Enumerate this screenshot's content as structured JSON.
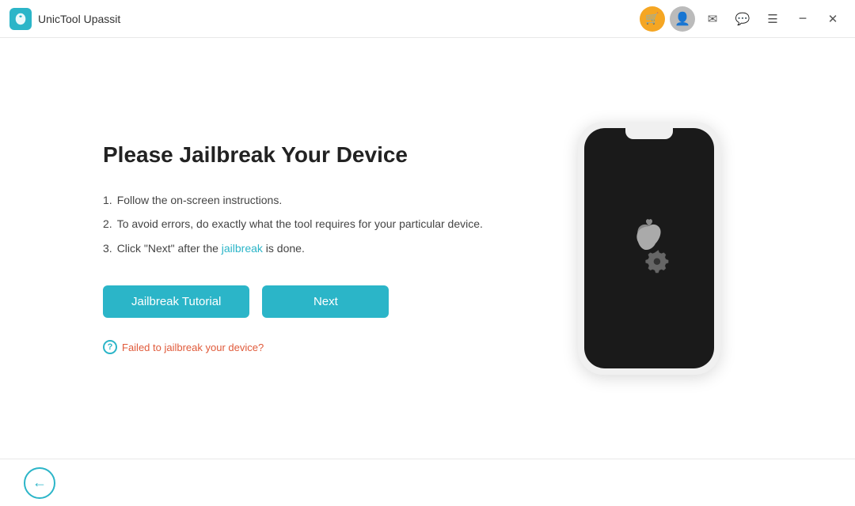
{
  "app": {
    "title": "UnicTool Upassit",
    "icon_symbol": "🔐"
  },
  "titlebar": {
    "cart_icon": "🛒",
    "profile_icon": "👤",
    "mail_icon": "✉",
    "chat_icon": "💬",
    "menu_icon": "☰",
    "minimize_label": "−",
    "close_label": "✕"
  },
  "main": {
    "title": "Please Jailbreak Your Device",
    "instructions": [
      {
        "num": "1.",
        "text": "Follow the on-screen instructions.",
        "highlight": ""
      },
      {
        "num": "2.",
        "text_before": "To avoid errors, do exactly what the tool requires for your particular device.",
        "highlight": ""
      },
      {
        "num": "3.",
        "text_before": "Click \"Next\" after the ",
        "highlight": "jailbreak",
        "text_after": " is done."
      }
    ],
    "btn_tutorial": "Jailbreak Tutorial",
    "btn_next": "Next",
    "fail_label": "Failed to jailbreak your device?"
  },
  "footer": {
    "back_icon": "←"
  }
}
